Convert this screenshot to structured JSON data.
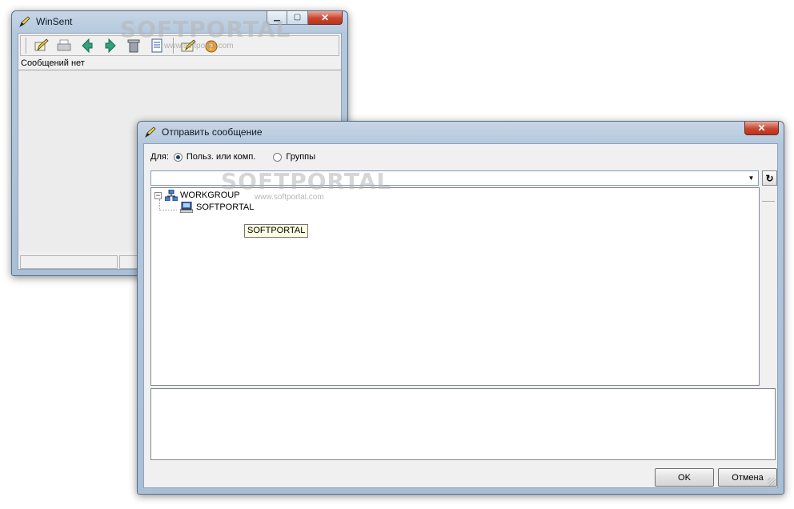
{
  "main_window": {
    "title": "WinSent",
    "toolbar_icons": [
      "write-message-icon",
      "print-icon",
      "back-arrow-icon",
      "forward-arrow-icon",
      "delete-icon",
      "list-icon",
      "settings-icon",
      "help-icon"
    ],
    "message_status": "Сообщений нет"
  },
  "send_dialog": {
    "title": "Отправить сообщение",
    "for_label": "Для:",
    "radio_options": [
      {
        "label": "Польз. или комп.",
        "selected": true
      },
      {
        "label": "Группы",
        "selected": false
      }
    ],
    "recipient_value": "",
    "tree": {
      "group": "WORKGROUP",
      "computers": [
        "SOFTPORTAL"
      ]
    },
    "tooltip": "SOFTPORTAL",
    "ok_label": "OK",
    "cancel_label": "Отмена"
  },
  "watermark": {
    "text": "SOFTPORTAL",
    "url": "www.softportal.com"
  },
  "colors": {
    "title_bar": "#b4c8dd",
    "client_bg": "#f0f0f0",
    "close_button": "#c9452e",
    "tooltip_bg": "#ffffe1"
  }
}
